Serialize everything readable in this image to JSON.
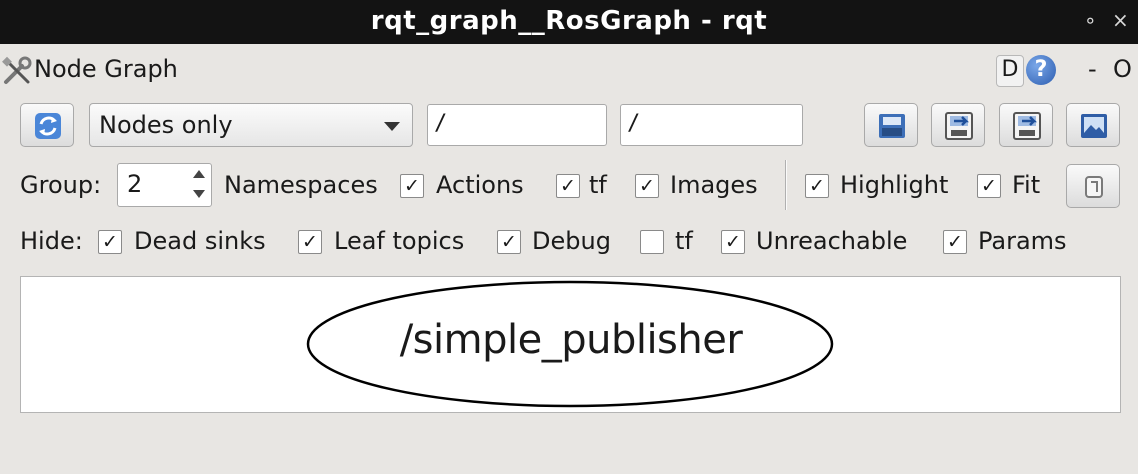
{
  "window": {
    "title": "rqt_graph__RosGraph - rqt",
    "controls": [
      "∘",
      "×"
    ]
  },
  "panel": {
    "title": "Node Graph",
    "d_label": "D",
    "help_label": "?",
    "minus_label": "-",
    "zero_label": "O"
  },
  "toolbar": {
    "graph_type": "Nodes only",
    "node_filter": "/",
    "topic_filter": "/"
  },
  "group_row": {
    "group_label": "Group:",
    "group_value": "2",
    "checks": [
      {
        "label": "Namespaces",
        "checked": true
      },
      {
        "label": "Actions",
        "checked": true
      },
      {
        "label": "tf",
        "checked": true
      },
      {
        "label": "Images",
        "checked": false
      },
      {
        "label": "Highlight",
        "checked": true
      },
      {
        "label": "Fit",
        "checked": true
      }
    ],
    "checkmark": "✓"
  },
  "hide_row": {
    "hide_label": "Hide:",
    "checks": [
      {
        "label": "Dead sinks",
        "checked": true
      },
      {
        "label": "Leaf topics",
        "checked": true
      },
      {
        "label": "Debug",
        "checked": true
      },
      {
        "label": "tf",
        "checked": false
      },
      {
        "label": "Unreachable",
        "checked": true
      },
      {
        "label": "Params",
        "checked": true
      }
    ]
  },
  "graph": {
    "nodes": [
      {
        "name": "/simple_publisher"
      }
    ]
  },
  "colors": {
    "titlebar": "#131313",
    "panel": "#e8e6e3",
    "canvas": "#ffffff"
  }
}
